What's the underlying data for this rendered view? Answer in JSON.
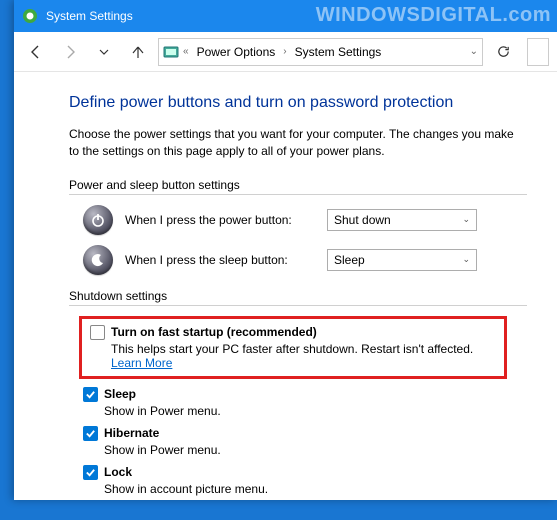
{
  "titlebar": {
    "title": "System Settings"
  },
  "watermark": "WINDOWSDIGITAL.com",
  "breadcrumb": {
    "item1": "Power Options",
    "item2": "System Settings"
  },
  "page": {
    "title": "Define power buttons and turn on password protection",
    "description": "Choose the power settings that you want for your computer. The changes you make to the settings on this page apply to all of your power plans."
  },
  "section_power": {
    "header": "Power and sleep button settings",
    "row1_label": "When I press the power button:",
    "row1_value": "Shut down",
    "row2_label": "When I press the sleep button:",
    "row2_value": "Sleep"
  },
  "section_shutdown": {
    "header": "Shutdown settings",
    "fast_startup": {
      "label": "Turn on fast startup (recommended)",
      "sub": "This helps start your PC faster after shutdown. Restart isn't affected.",
      "link": "Learn More"
    },
    "sleep": {
      "label": "Sleep",
      "sub": "Show in Power menu."
    },
    "hibernate": {
      "label": "Hibernate",
      "sub": "Show in Power menu."
    },
    "lock": {
      "label": "Lock",
      "sub": "Show in account picture menu."
    }
  }
}
